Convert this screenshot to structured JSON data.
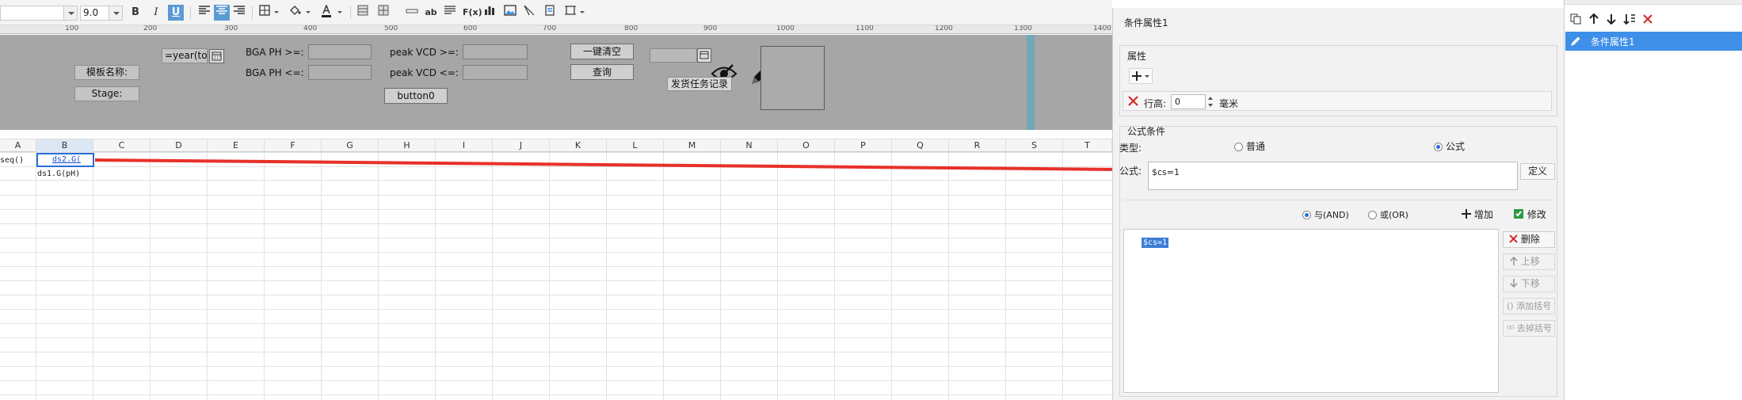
{
  "toolbar": {
    "font_size": "9.0",
    "bold_label": "B",
    "italic_label": "I",
    "underline_label": "U"
  },
  "ruler": {
    "labels": [
      "100",
      "200",
      "300",
      "400",
      "500",
      "600",
      "700",
      "800",
      "900",
      "1000",
      "1100",
      "1200",
      "1300",
      "1400"
    ]
  },
  "param_pane": {
    "template_name_label": "模板名称:",
    "stage_label": "Stage:",
    "date_widget_value": "=year(tod",
    "bga_ph_min_label": "BGA PH >=:",
    "bga_ph_max_label": "BGA PH <=:",
    "peak_vcd_min_label": "peak VCD >=:",
    "peak_vcd_max_label": "peak VCD <=:",
    "clear_all_button": "一键清空",
    "query_button": "查询",
    "button0_label": "button0",
    "send_task_label": "发货任务记录"
  },
  "sheet": {
    "columns": [
      "A",
      "B",
      "C",
      "D",
      "E",
      "F",
      "G",
      "H",
      "I",
      "J",
      "K",
      "L",
      "M",
      "N",
      "O",
      "P",
      "Q",
      "R",
      "S",
      "T"
    ],
    "selected_column": "B",
    "cells": {
      "a1": "seq()",
      "b1": "ds2.G(",
      "b2": "ds1.G(pH)"
    }
  },
  "dialog": {
    "title": "条件属性1",
    "attributes_section": "属性",
    "row_height_label": "行高:",
    "row_height_value": "0",
    "row_height_unit": "毫米",
    "formula_condition_section": "公式条件",
    "type_label": "类型:",
    "type_options": [
      "普通",
      "公式"
    ],
    "type_selected": "公式",
    "formula_label": "公式:",
    "formula_value": "$cs=1",
    "define_button": "定义",
    "logic_options": [
      "与(AND)",
      "或(OR)"
    ],
    "logic_selected": "与(AND)",
    "add_button": "增加",
    "modify_button": "修改",
    "delete_button": "删除",
    "move_up_button": "上移",
    "move_down_button": "下移",
    "add_bracket_button": "添加括号",
    "remove_bracket_button": "去掉括号",
    "condition_list": [
      "$cs=1"
    ]
  },
  "outline": {
    "items": [
      "条件属性1"
    ]
  },
  "colors": {
    "accent": "#3d8fe8",
    "param_bg": "#a6a6a6",
    "arrow": "#e8302a",
    "delete_red": "#d0302a"
  }
}
